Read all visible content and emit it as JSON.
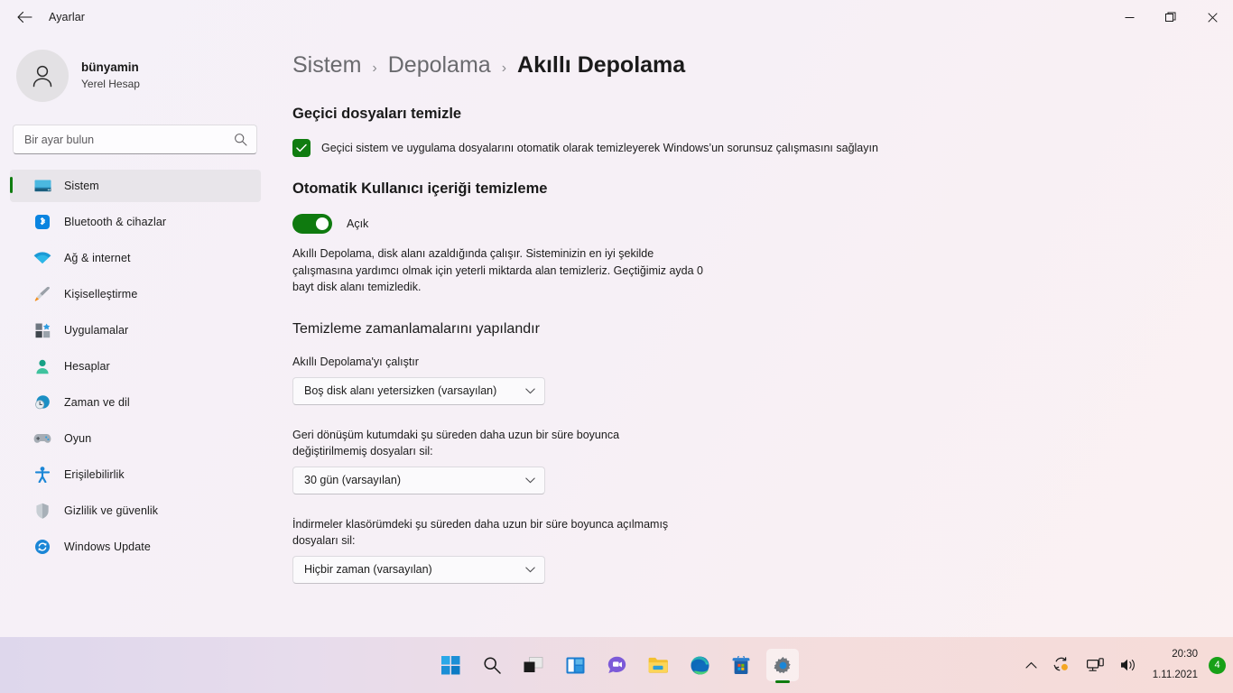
{
  "window": {
    "title": "Ayarlar",
    "back_icon": "back-arrow-icon",
    "minimize_label": "—",
    "restore_label": "❐",
    "close_label": "✕"
  },
  "sidebar": {
    "account": {
      "name": "bünyamin",
      "subtitle": "Yerel Hesap",
      "avatar_icon": "person-avatar-icon"
    },
    "search": {
      "placeholder": "Bir ayar bulun",
      "value": "",
      "icon": "search-icon"
    },
    "items": [
      {
        "label": "Sistem",
        "icon": "monitor-icon",
        "active": true
      },
      {
        "label": "Bluetooth & cihazlar",
        "icon": "bluetooth-icon",
        "active": false
      },
      {
        "label": "Ağ & internet",
        "icon": "wifi-icon",
        "active": false
      },
      {
        "label": "Kişiselleştirme",
        "icon": "paintbrush-icon",
        "active": false
      },
      {
        "label": "Uygulamalar",
        "icon": "apps-grid-icon",
        "active": false
      },
      {
        "label": "Hesaplar",
        "icon": "accounts-person-icon",
        "active": false
      },
      {
        "label": "Zaman ve dil",
        "icon": "clock-globe-icon",
        "active": false
      },
      {
        "label": "Oyun",
        "icon": "gamepad-icon",
        "active": false
      },
      {
        "label": "Erişilebilirlik",
        "icon": "accessibility-person-icon",
        "active": false
      },
      {
        "label": "Gizlilik ve güvenlik",
        "icon": "shield-icon",
        "active": false
      },
      {
        "label": "Windows Update",
        "icon": "update-refresh-icon",
        "active": false
      }
    ]
  },
  "breadcrumb": {
    "root": "Sistem",
    "parent": "Depolama",
    "current": "Akıllı Depolama",
    "separator": "›"
  },
  "main": {
    "temp_files": {
      "heading": "Geçici dosyaları temizle",
      "checkbox_label": "Geçici sistem ve uygulama dosyalarını otomatik olarak temizleyerek Windows’un sorunsuz çalışmasını sağlayın",
      "checked": true
    },
    "auto_clean": {
      "heading": "Otomatik Kullanıcı içeriği temizleme",
      "toggle_state": "Açık",
      "toggle_on": true,
      "description": "Akıllı Depolama, disk alanı azaldığında çalışır. Sisteminizin en iyi şekilde çalışmasına yardımcı olmak için yeterli miktarda alan temizleriz. Geçtiğimiz ayda 0 bayt disk alanı temizledik."
    },
    "schedules": {
      "heading": "Temizleme zamanlamalarını yapılandır",
      "fields": [
        {
          "label": "Akıllı Depolama'yı çalıştır",
          "value": "Boş disk alanı yetersizken (varsayılan)",
          "chevron": "chevron-down-icon"
        },
        {
          "label": "Geri dönüşüm kutumdaki şu süreden daha uzun bir süre boyunca değiştirilmemiş dosyaları sil:",
          "value": "30 gün (varsayılan)",
          "chevron": "chevron-down-icon"
        },
        {
          "label": "İndirmeler klasörümdeki şu süreden daha uzun bir süre boyunca açılmamış dosyaları sil:",
          "value": "Hiçbir zaman (varsayılan)",
          "chevron": "chevron-down-icon"
        }
      ]
    }
  },
  "taskbar": {
    "items": [
      {
        "name": "start-button",
        "icon": "windows-logo-icon",
        "active": false
      },
      {
        "name": "search-button",
        "icon": "search-icon",
        "active": false
      },
      {
        "name": "task-view-button",
        "icon": "task-view-icon",
        "active": false
      },
      {
        "name": "widgets-button",
        "icon": "widgets-icon",
        "active": false
      },
      {
        "name": "chat-button",
        "icon": "chat-video-icon",
        "active": false
      },
      {
        "name": "file-explorer-button",
        "icon": "folder-icon",
        "active": false
      },
      {
        "name": "edge-button",
        "icon": "edge-browser-icon",
        "active": false
      },
      {
        "name": "store-button",
        "icon": "microsoft-store-icon",
        "active": false
      },
      {
        "name": "settings-button",
        "icon": "gear-icon",
        "active": true
      }
    ],
    "tray": {
      "overflow_icon": "chevron-up-icon",
      "onedrive_icon": "onedrive-sync-icon",
      "network_icon": "network-icon",
      "volume_icon": "speaker-icon",
      "time": "20:30",
      "date": "1.11.2021",
      "notification_count": "4"
    }
  },
  "colors": {
    "accent_green": "#107c10",
    "toggle_green": "#0f7a0f",
    "badge_green": "#17a017",
    "text_primary": "#1b1b1b",
    "text_muted": "#6a6a6e",
    "page_bg": "#f3f0f7"
  }
}
